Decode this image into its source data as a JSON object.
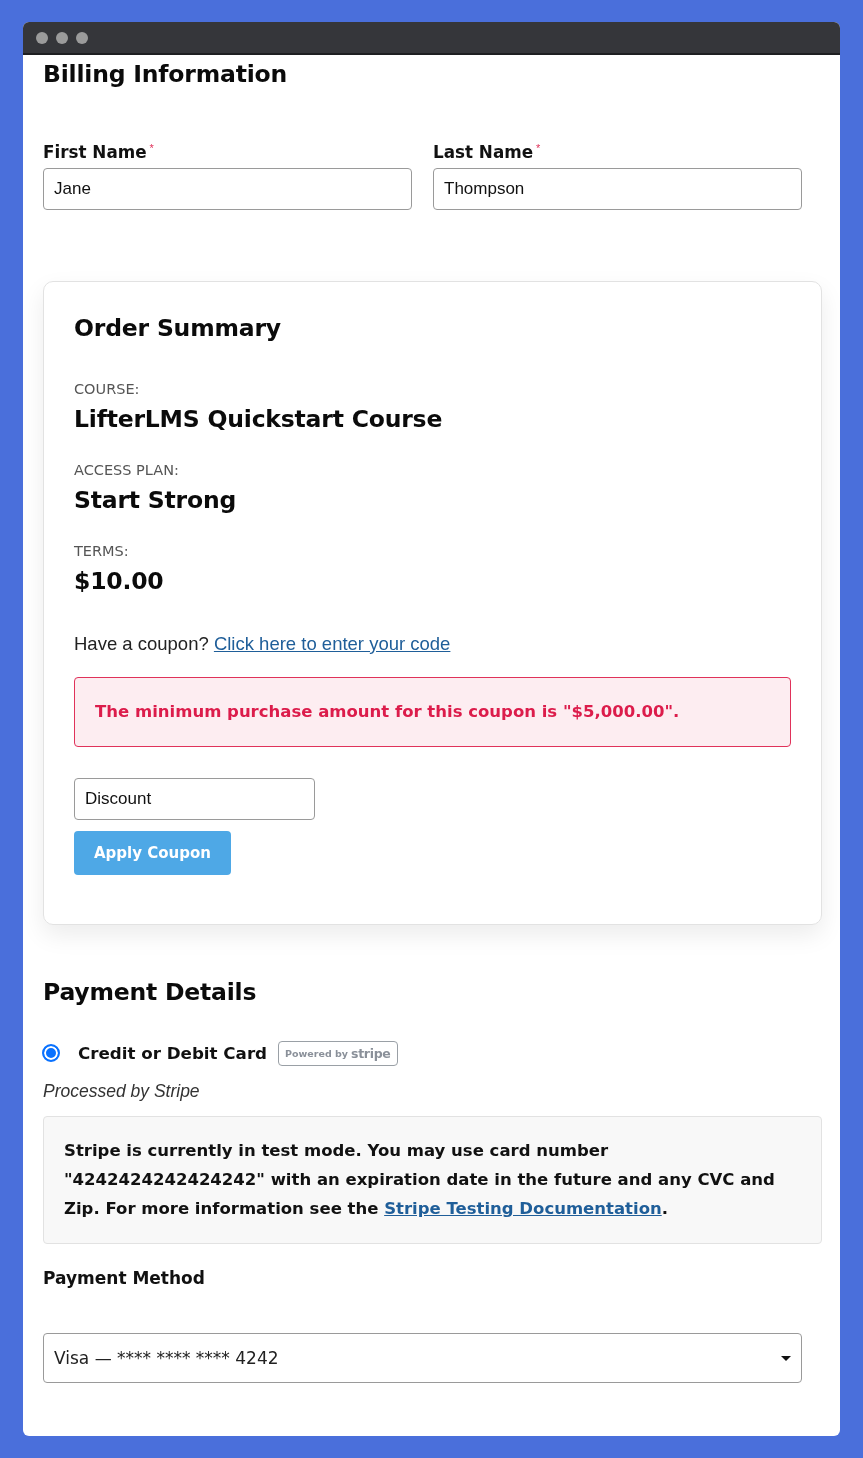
{
  "billing": {
    "title": "Billing Information",
    "fields": [
      {
        "label": "First Name",
        "required_mark": "*",
        "value": "Jane"
      },
      {
        "label": "Last Name",
        "required_mark": "*",
        "value": "Thompson"
      }
    ]
  },
  "order_summary": {
    "title": "Order Summary",
    "items": [
      {
        "label": "COURSE:",
        "value": "LifterLMS Quickstart Course"
      },
      {
        "label": "ACCESS PLAN:",
        "value": "Start Strong"
      },
      {
        "label": "TERMS:",
        "value": "$10.00"
      }
    ],
    "coupon_prompt": "Have a coupon?",
    "coupon_link": "Click here to enter your code",
    "error": "The minimum purchase amount for this coupon is \"$5,000.00\".",
    "coupon_field": {
      "value": "Discount"
    },
    "apply_button": "Apply Coupon"
  },
  "payment": {
    "title": "Payment Details",
    "methods": [
      {
        "label": "Credit or Debit Card",
        "selected": true,
        "badge_text": "Powered by",
        "badge_brand": "stripe",
        "note": "Processed by Stripe"
      }
    ],
    "notice": {
      "text": "Stripe is currently in test mode. You may use card number \"4242424242424242\" with an expiration date in the future and any CVC and Zip. For more information see the ",
      "link": "Stripe Testing Documentation",
      "after": "."
    },
    "method_field": {
      "label": "Payment Method",
      "value": "Visa — **** **** **** 4242"
    }
  }
}
